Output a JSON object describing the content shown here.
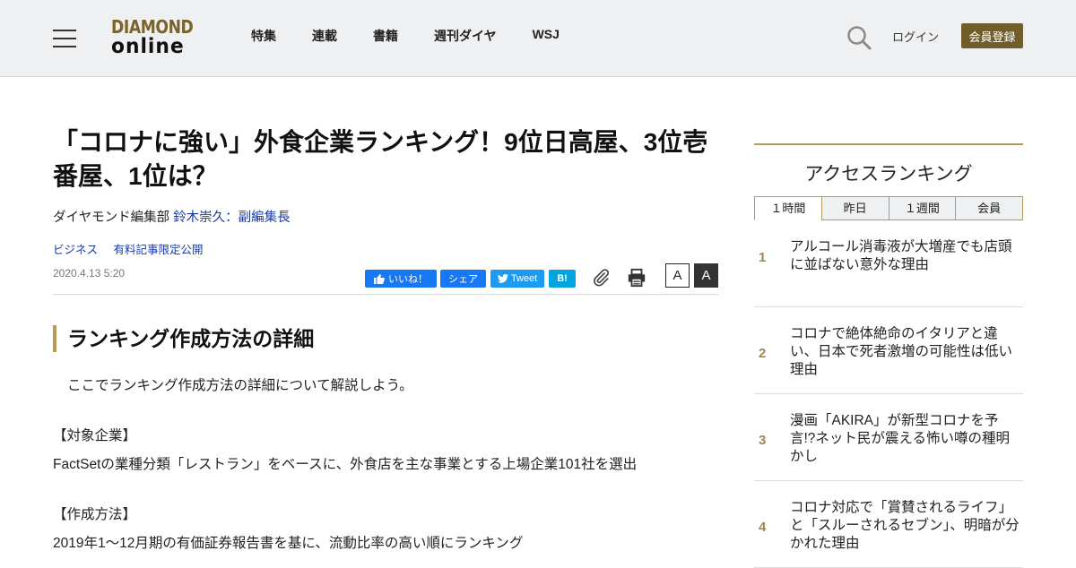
{
  "header": {
    "logo_top": "DIAMOND",
    "logo_bottom": "online",
    "nav": [
      "特集",
      "連載",
      "書籍",
      "週刊ダイヤ",
      "WSJ"
    ],
    "login": "ログイン",
    "register": "会員登録"
  },
  "article": {
    "title": "「コロナに強い」外食企業ランキング！9位日高屋、3位壱番屋、1位は？",
    "byline_dept": "ダイヤモンド編集部",
    "byline_author": "鈴木崇久：副編集長",
    "tags": [
      "ビジネス",
      "有料記事限定公開"
    ],
    "date": "2020.4.13 5:20",
    "share": {
      "like": "いいね！",
      "share": "シェア",
      "tweet": "Tweet",
      "hatena": "B!"
    },
    "font_small": "A",
    "font_large": "A",
    "section_heading": "ランキング作成方法の詳細",
    "intro": "ここでランキング作成方法の詳細について解説しよう。",
    "target_label": "【対象企業】",
    "target_text": "FactSetの業種分類「レストラン」をベースに、外食店を主な事業とする上場企業101社を選出",
    "method_label": "【作成方法】",
    "method_text": "2019年1～12月期の有価証券報告書を基に、流動比率の高い順にランキング"
  },
  "sidebar": {
    "title": "アクセスランキング",
    "tabs": [
      "１時間",
      "昨日",
      "１週間",
      "会員"
    ],
    "active_tab": 0,
    "items": [
      {
        "rank": "1",
        "title": "アルコール消毒液が大増産でも店頭に並ばない意外な理由"
      },
      {
        "rank": "2",
        "title": "コロナで絶体絶命のイタリアと違い、日本で死者激増の可能性は低い理由"
      },
      {
        "rank": "3",
        "title": "漫画「AKIRA」が新型コロナを予言!?ネット民が震える怖い噂の種明かし"
      },
      {
        "rank": "4",
        "title": "コロナ対応で「賞賛されるライフ」と「スルーされるセブン」、明暗が分かれた理由"
      }
    ]
  }
}
